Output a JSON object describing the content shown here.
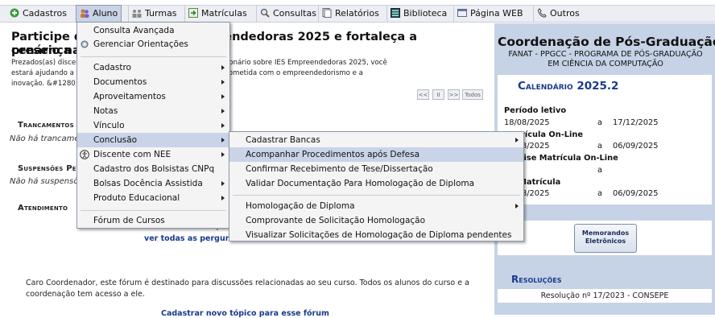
{
  "menubar": {
    "items": [
      {
        "label": "Cadastros",
        "icon": "plus-circle-icon"
      },
      {
        "label": "Aluno",
        "icon": "users-icon"
      },
      {
        "label": "Turmas",
        "icon": "people-icon"
      },
      {
        "label": "Matrículas",
        "icon": "arrow-icon"
      },
      {
        "label": "Consultas",
        "icon": "search-icon"
      },
      {
        "label": "Relatórios",
        "icon": "document-icon"
      },
      {
        "label": "Biblioteca",
        "icon": "book-icon"
      },
      {
        "label": "Página WEB",
        "icon": "web-icon"
      },
      {
        "label": "Outros",
        "icon": "phone-icon"
      }
    ]
  },
  "main": {
    "title_line1": "Participe da pesquisa IES Empreendedoras 2025 e fortaleça a presença da UERN no",
    "title_line2": "cenário nacional!",
    "text_line1": "Prezados(as) discentes, convidamos você a responder o questionário sobre IES Empreendedoras 2025, você",
    "text_line2": "estará ajudando a fortalecer a imagem da universidade comprometida com o empreendedorismo e a",
    "text_line3": "inovação. &#1280 https://pt.surveymonkey...",
    "pager": [
      "<<",
      "II",
      ">>",
      "Todos"
    ],
    "sections": [
      {
        "heading": "Trancamentos",
        "empty": "Não há trancamentos"
      },
      {
        "heading": "Suspensões Pendentes",
        "empty": "Não há suspensões"
      },
      {
        "heading": "Atendimento",
        "empty": ""
      }
    ],
    "forum_partial": "Não há pe",
    "forum_link": "ver todas as perguntas",
    "forum_text": "Caro Coordenador, este fórum é destinado para discussões relacionadas ao seu curso. Todos os alunos do curso e a coordenação tem acesso a ele.",
    "cut_text": "Cadastrar novo tópico para esse fórum"
  },
  "sidebar": {
    "title": "Coordenação de Pós-Graduação",
    "subtitle_line1": "FANAT - PPGCC - PROGRAMA DE PÓS-GRADUAÇÃO",
    "subtitle_line2": "EM CIÊNCIA DA COMPUTAÇÃO",
    "calendar_title": "Calendário 2025.2",
    "rows": [
      {
        "label": "Período letivo",
        "start": "18/08/2025",
        "sep": "a",
        "end": "17/12/2025"
      },
      {
        "label": "Matrícula On-Line",
        "start": "18/08/2025",
        "sep": "a",
        "end": "06/09/2025"
      },
      {
        "label": "Análise Matrícula On-Line",
        "start": "",
        "sep": "a",
        "end": ""
      },
      {
        "label": "Re-Matrícula",
        "start": "18/08/2025",
        "sep": "a",
        "end": "06/09/2025"
      }
    ],
    "memo_line1": "Memorandos",
    "memo_line2": "Eletrônicos",
    "resolutions_title": "Resoluções",
    "resolution_item": "Resolução nº 17/2023 - CONSEPE"
  },
  "aluno_menu": {
    "items": [
      "Consulta Avançada",
      "Gerenciar Orientações",
      "Cadastro",
      "Documentos",
      "Aproveitamentos",
      "Notas",
      "Vínculo",
      "Conclusão",
      "Discente com NEE",
      "Cadastro dos Bolsistas CNPq",
      "Bolsas Docência Assistida",
      "Produto Educacional",
      "Fórum de Cursos"
    ]
  },
  "conclusao_menu": {
    "items": [
      "Cadastrar Bancas",
      "Acompanhar Procedimentos após Defesa",
      "Confirmar Recebimento de Tese/Dissertação",
      "Validar Documentação Para Homologação de Diploma",
      "Homologação de Diploma",
      "Comprovante de Solicitação Homologação",
      "Visualizar Solicitações de Homologação de Diploma pendentes"
    ]
  }
}
